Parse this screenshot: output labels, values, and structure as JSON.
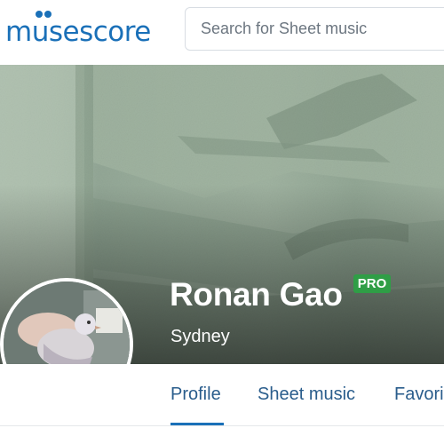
{
  "header": {
    "logo_text_before": "m",
    "logo_text_after": "sescore",
    "logo_u": "u",
    "search_placeholder": "Search for Sheet music"
  },
  "profile": {
    "name": "Ronan Gao",
    "badge": "PRO",
    "location": "Sydney"
  },
  "tabs": [
    {
      "label": "Profile",
      "active": true
    },
    {
      "label": "Sheet music",
      "active": false
    },
    {
      "label": "Favori",
      "active": false
    }
  ],
  "colors": {
    "brand": "#1a70b8",
    "pro_badge": "#2f9e46",
    "tab_text": "#2a5d8c"
  }
}
